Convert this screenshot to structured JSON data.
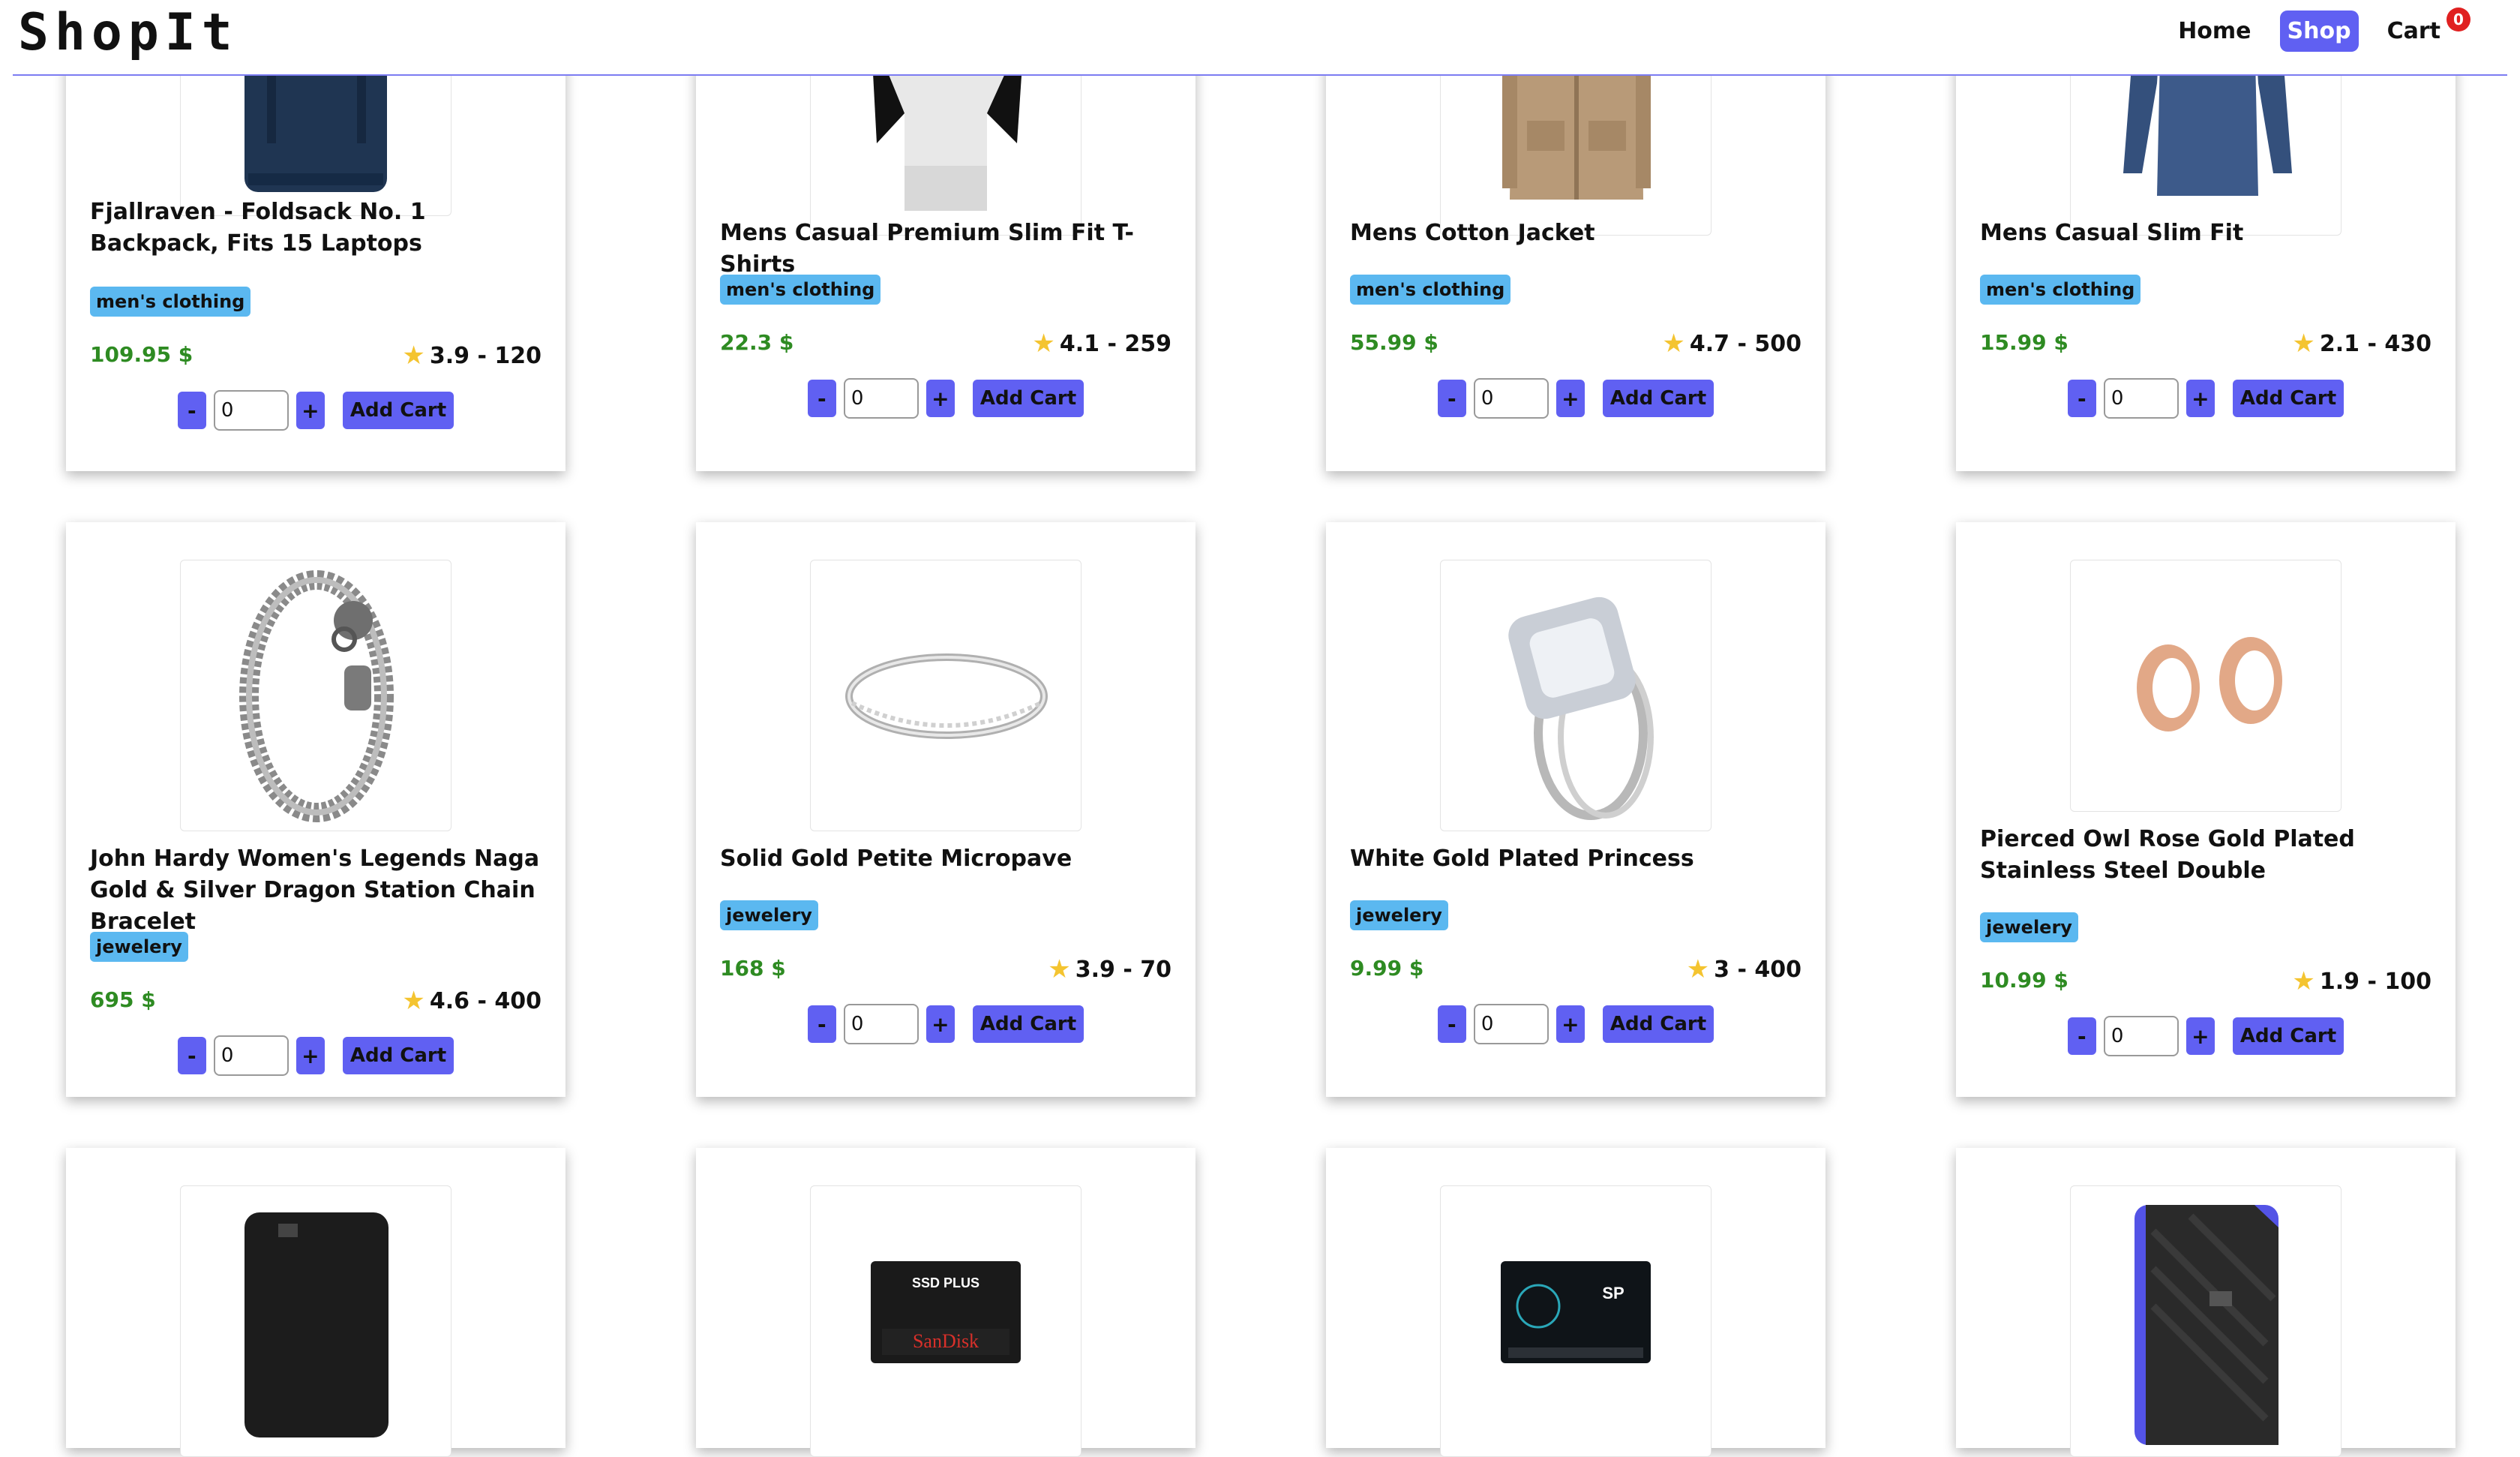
{
  "header": {
    "logo": "ShopIt",
    "nav": [
      {
        "label": "Home",
        "active": false
      },
      {
        "label": "Shop",
        "active": true
      },
      {
        "label": "Cart",
        "active": false
      }
    ],
    "cart_count": "0"
  },
  "controls": {
    "minus": "-",
    "plus": "+",
    "add_cart": "Add Cart",
    "qty": "0"
  },
  "colors": {
    "accent": "#6060f2",
    "badge": "#5bb8f0",
    "price": "#2e8b22",
    "star": "#f4c430",
    "cart_badge": "#e02020"
  },
  "products": [
    {
      "title": "Fjallraven - Foldsack No. 1 Backpack, Fits 15 Laptops",
      "category": "men's clothing",
      "price": "109.95 $",
      "rating": "3.9 - 120",
      "image": "backpack"
    },
    {
      "title": "Mens Casual Premium Slim Fit T-Shirts",
      "category": "men's clothing",
      "price": "22.3 $",
      "rating": "4.1 - 259",
      "image": "tshirt"
    },
    {
      "title": "Mens Cotton Jacket",
      "category": "men's clothing",
      "price": "55.99 $",
      "rating": "4.7 - 500",
      "image": "jacket"
    },
    {
      "title": "Mens Casual Slim Fit",
      "category": "men's clothing",
      "price": "15.99 $",
      "rating": "2.1 - 430",
      "image": "longsleeve"
    },
    {
      "title": "John Hardy Women's Legends Naga Gold & Silver Dragon Station Chain Bracelet",
      "category": "jewelery",
      "price": "695 $",
      "rating": "4.6 - 400",
      "image": "bracelet"
    },
    {
      "title": "Solid Gold Petite Micropave",
      "category": "jewelery",
      "price": "168 $",
      "rating": "3.9 - 70",
      "image": "ring"
    },
    {
      "title": "White Gold Plated Princess",
      "category": "jewelery",
      "price": "9.99 $",
      "rating": "3 - 400",
      "image": "princess-ring"
    },
    {
      "title": "Pierced Owl Rose Gold Plated Stainless Steel Double",
      "category": "jewelery",
      "price": "10.99 $",
      "rating": "1.9 - 100",
      "image": "plugs"
    },
    {
      "title": "",
      "category": "",
      "price": "",
      "rating": "",
      "image": "hard-drive"
    },
    {
      "title": "",
      "category": "",
      "price": "",
      "rating": "",
      "image": "sandisk-ssd"
    },
    {
      "title": "",
      "category": "",
      "price": "",
      "rating": "",
      "image": "sp-ssd"
    },
    {
      "title": "",
      "category": "",
      "price": "",
      "rating": "",
      "image": "portable-drive"
    }
  ]
}
